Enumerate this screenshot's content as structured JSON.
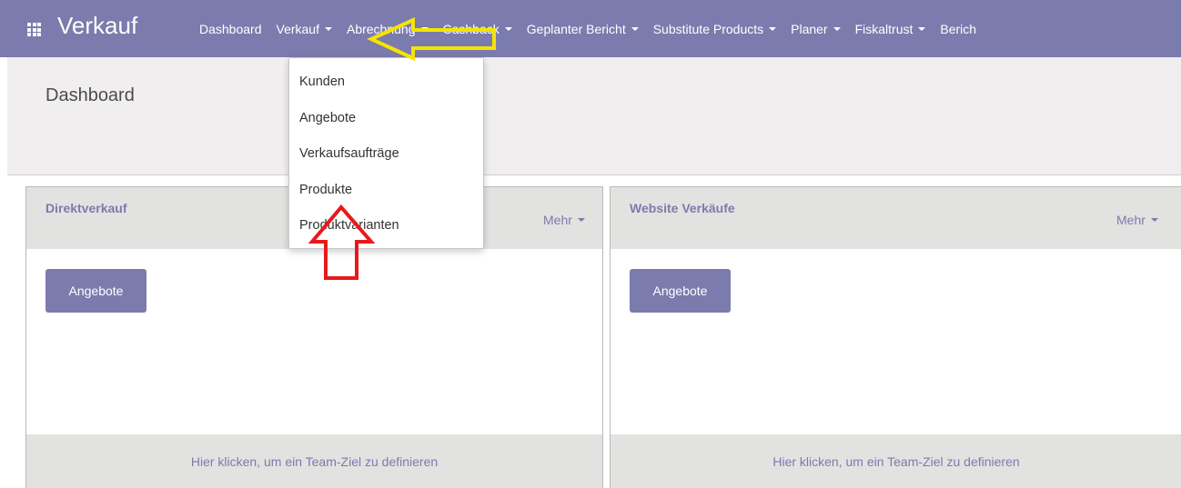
{
  "navbar": {
    "app_title": "Verkauf",
    "menu": [
      {
        "label": "Dashboard",
        "has_caret": false
      },
      {
        "label": "Verkauf",
        "has_caret": true
      },
      {
        "label": "Abrechnung",
        "has_caret": true
      },
      {
        "label": "Cashback",
        "has_caret": true
      },
      {
        "label": "Geplanter Bericht",
        "has_caret": true
      },
      {
        "label": "Substitute Products",
        "has_caret": true
      },
      {
        "label": "Planer",
        "has_caret": true
      },
      {
        "label": "Fiskaltrust",
        "has_caret": true
      },
      {
        "label": "Berich",
        "has_caret": false
      }
    ]
  },
  "control_panel": {
    "title": "Dashboard"
  },
  "dropdown": {
    "items": [
      "Kunden",
      "Angebote",
      "Verkaufsaufträge",
      "Produkte",
      "Produktvarianten"
    ]
  },
  "cards": [
    {
      "title": "Direktverkauf",
      "more_label": "Mehr",
      "button_label": "Angebote",
      "footer_text": "Hier klicken, um ein Team-Ziel zu definieren"
    },
    {
      "title": "Website Verkäufe",
      "more_label": "Mehr",
      "button_label": "Angebote",
      "footer_text": "Hier klicken, um ein Team-Ziel zu definieren"
    }
  ],
  "colors": {
    "brand": "#7c7bad",
    "panel_bg": "#f0eeee",
    "card_header_bg": "#e2e2e0",
    "annotation_yellow": "#f5e400",
    "annotation_red": "#e8191c"
  },
  "icons": {
    "apps": "apps-grid-icon",
    "caret": "caret-down-icon"
  }
}
